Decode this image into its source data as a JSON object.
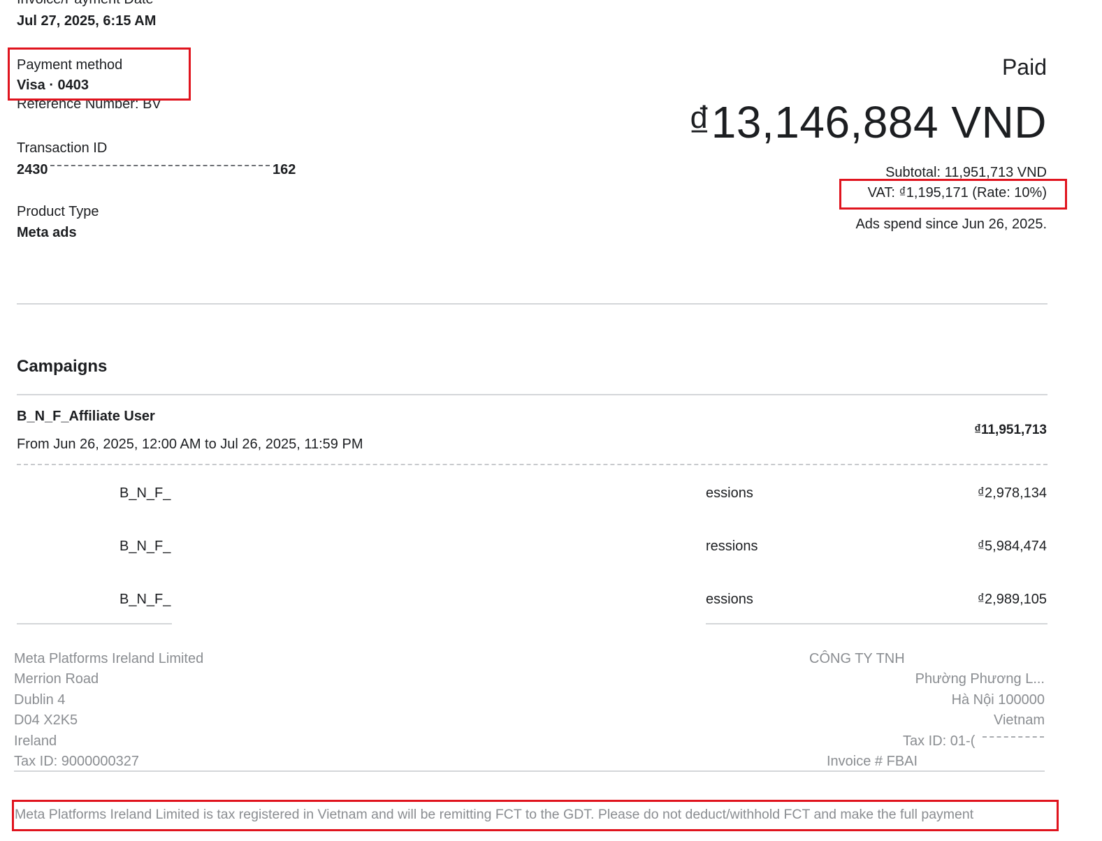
{
  "invoice": {
    "date_label": "Invoice/Payment Date",
    "date_value": "Jul 27, 2025, 6:15 AM",
    "payment_method_label": "Payment method",
    "payment_method_value": "Visa · 0403",
    "reference_label": "Reference Number: BV",
    "transaction_label": "Transaction ID",
    "transaction_value_start": "2430",
    "transaction_value_end": "162",
    "product_type_label": "Product Type",
    "product_type_value": "Meta ads"
  },
  "summary": {
    "status": "Paid",
    "total": "₫13,146,884 VND",
    "subtotal": "Subtotal: 11,951,713 VND",
    "vat": "VAT: ₫1,195,171 (Rate: 10%)",
    "ads_spend": "Ads spend since Jun 26, 2025."
  },
  "campaigns": {
    "heading": "Campaigns",
    "name": "B_N_F_Affiliate User",
    "period": "From Jun 26, 2025, 12:00 AM to Jul 26, 2025, 11:59 PM",
    "total": "₫11,951,713",
    "rows": [
      {
        "name": "B_N_F_",
        "metric": "essions",
        "amount": "₫2,978,134"
      },
      {
        "name": "B_N_F_",
        "metric": "ressions",
        "amount": "₫5,984,474"
      },
      {
        "name": "B_N_F_",
        "metric": "essions",
        "amount": "₫2,989,105"
      }
    ]
  },
  "seller": {
    "lines": [
      "Meta Platforms Ireland Limited",
      "Merrion Road",
      "Dublin 4",
      "D04 X2K5",
      "Ireland",
      "Tax ID: 9000000327"
    ]
  },
  "buyer": {
    "lines": [
      "CÔNG TY TNH",
      "Phường Phương L...",
      "Hà Nội 100000",
      "Vietnam",
      "Tax ID: 01-(",
      "Invoice # FBAI"
    ]
  },
  "notice": "Meta Platforms Ireland Limited is tax registered in Vietnam and will be remitting FCT to the GDT. Please do not deduct/withhold FCT and make the full payment",
  "colors": {
    "highlight": "#e0141e",
    "divider": "#d4d6d9",
    "muted": "#8a8d91"
  }
}
